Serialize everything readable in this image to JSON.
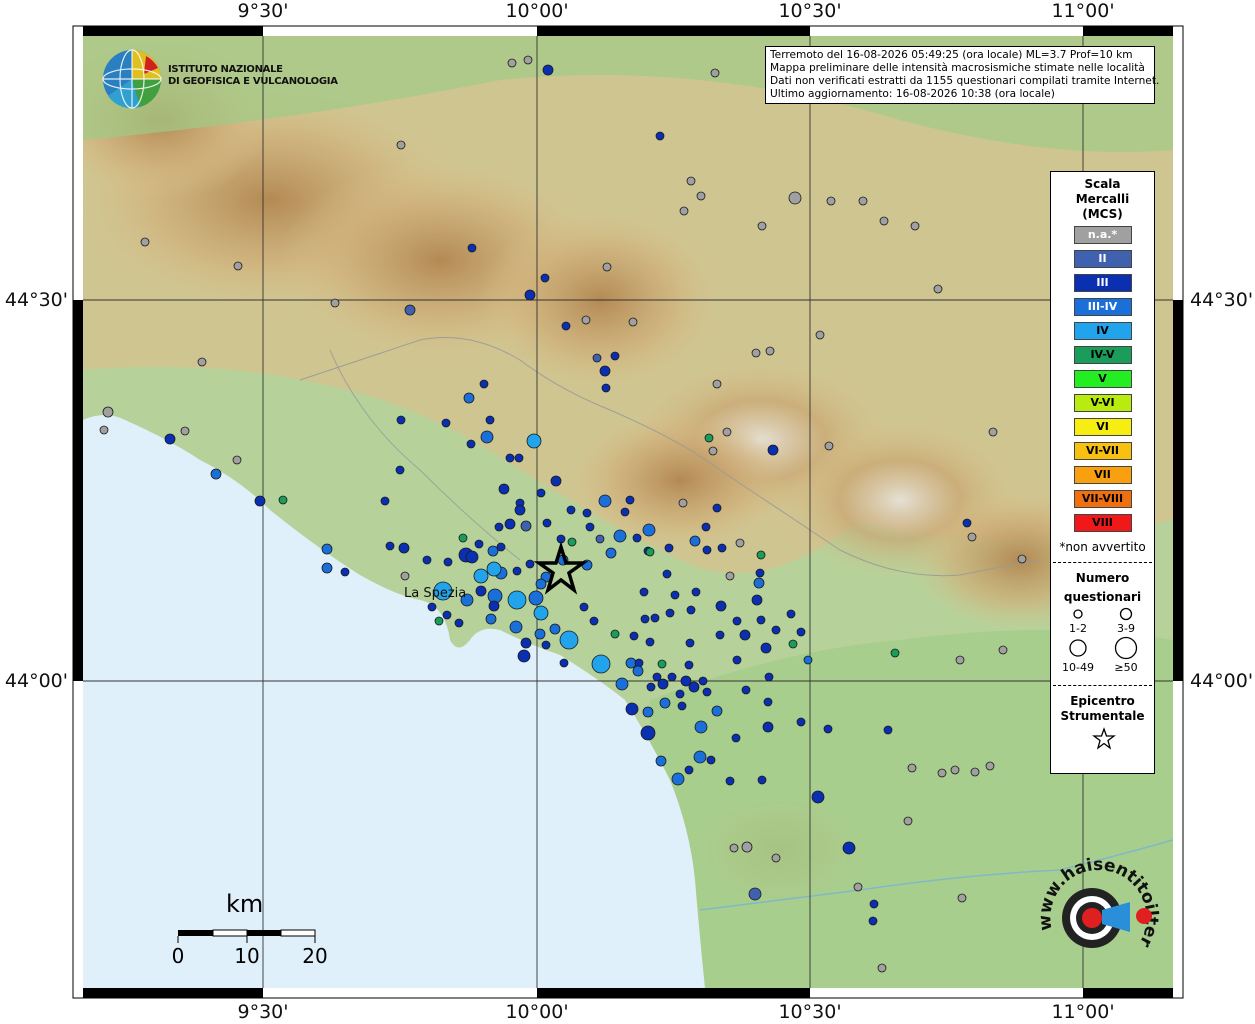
{
  "coords": {
    "top": [
      "9°30'",
      "10°00'",
      "10°30'",
      "11°00'"
    ],
    "bottom": [
      "9°30'",
      "10°00'",
      "10°30'",
      "11°00'"
    ],
    "left": [
      "44°30'",
      "44°00'"
    ],
    "right": [
      "44°30'",
      "44°00'"
    ]
  },
  "info": {
    "line1": "Terremoto del 16-08-2026 05:49:25 (ora locale) ML=3.7 Prof=10 km",
    "line2": "Mappa preliminare delle intensità macrosismiche stimate nelle località",
    "line3": "Dati non verificati estratti da 1155 questionari compilati tramite Internet.",
    "line4": "Ultimo aggiornamento: 16-08-2026 10:38 (ora locale)"
  },
  "institute": {
    "line1": "ISTITUTO NAZIONALE",
    "line2": "DI GEOFISICA E VULCANOLOGIA"
  },
  "legend": {
    "title1": "Scala",
    "title2": "Mercalli",
    "title3": "(MCS)",
    "items": [
      {
        "label": "n.a.*",
        "color": "#a0a0a0",
        "text_color": "#ffffff"
      },
      {
        "label": "II",
        "color": "#4060b0",
        "text_color": "#ffffff"
      },
      {
        "label": "III",
        "color": "#0a2fb0",
        "text_color": "#ffffff"
      },
      {
        "label": "III-IV",
        "color": "#1a6fd8",
        "text_color": "#ffffff"
      },
      {
        "label": "IV",
        "color": "#22a4ec",
        "text_color": "#000000"
      },
      {
        "label": "IV-V",
        "color": "#1a9c5a",
        "text_color": "#000000"
      },
      {
        "label": "V",
        "color": "#22ee22",
        "text_color": "#000000"
      },
      {
        "label": "V-VI",
        "color": "#b8ec10",
        "text_color": "#000000"
      },
      {
        "label": "VI",
        "color": "#f6ee10",
        "text_color": "#000000"
      },
      {
        "label": "VI-VII",
        "color": "#f8c010",
        "text_color": "#000000"
      },
      {
        "label": "VII",
        "color": "#f8a010",
        "text_color": "#000000"
      },
      {
        "label": "VII-VIII",
        "color": "#f07010",
        "text_color": "#000000"
      },
      {
        "label": "VIII",
        "color": "#f01818",
        "text_color": "#000000"
      }
    ],
    "note": "*non avvertito",
    "count_title1": "Numero",
    "count_title2": "questionari",
    "sizes": [
      "1-2",
      "3-9",
      "10-49",
      "≥50"
    ],
    "epi_title1": "Epicentro",
    "epi_title2": "Strumentale"
  },
  "city": "La Spezia",
  "scale": {
    "unit": "km",
    "labels": [
      "0",
      "10",
      "20"
    ]
  },
  "hs_logo": {
    "text": "www.haisentitoilterremoto.it"
  },
  "colors": {
    "sea": "#e0f0fb",
    "land_low": "#a9cf8f",
    "land_mid": "#d9c08a",
    "land_high": "#b58a55"
  }
}
